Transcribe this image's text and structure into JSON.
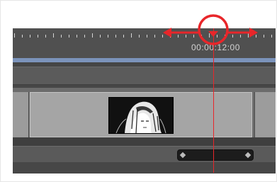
{
  "timeline": {
    "timecode": "00:00:12:00",
    "drawing_thumbnail_icon": "character-drawing-thumbnail"
  },
  "annotation": {
    "marker_color": "#e8262a",
    "icon": "drag-left-right-arrows"
  },
  "colors": {
    "range_bar": "#7b93bb",
    "panel": "#575757",
    "cell": "#a5a5a5"
  }
}
